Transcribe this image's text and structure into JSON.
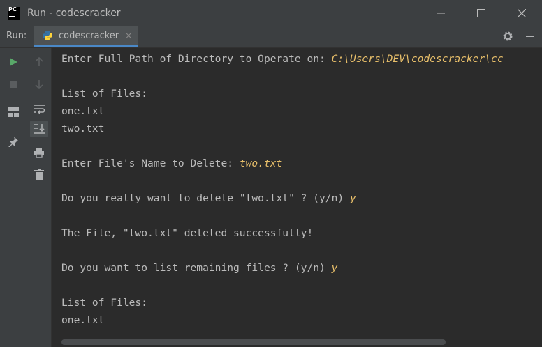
{
  "window": {
    "title": "Run - codescracker",
    "controls": [
      "minimize-icon",
      "maximize-icon",
      "close-icon"
    ]
  },
  "run_panel": {
    "label": "Run:",
    "tab": {
      "label": "codescracker",
      "icon": "python-icon",
      "close": "×"
    }
  },
  "left_toolbar": [
    "run-icon",
    "stop-icon",
    "layout-icon",
    "pin-icon"
  ],
  "second_toolbar": [
    "up-arrow-icon",
    "down-arrow-icon",
    "soft-wrap-icon",
    "scroll-to-end-icon",
    "print-icon",
    "trash-icon"
  ],
  "console": {
    "lines": [
      {
        "text": "Enter Full Path of Directory to Operate on: ",
        "input": "C:\\Users\\DEV\\codescracker\\cc"
      },
      {
        "text": "List of Files:",
        "input": ""
      },
      {
        "text": "one.txt",
        "input": ""
      },
      {
        "text": "two.txt",
        "input": ""
      },
      {
        "text": "Enter File's Name to Delete: ",
        "input": "two.txt"
      },
      {
        "text": "Do you really want to delete \"two.txt\" ? (y/n) ",
        "input": "y"
      },
      {
        "text": "The File, \"two.txt\" deleted successfully!",
        "input": ""
      },
      {
        "text": "Do you want to list remaining files ? (y/n) ",
        "input": "y"
      },
      {
        "text": "List of Files:",
        "input": ""
      },
      {
        "text": "one.txt",
        "input": ""
      }
    ]
  },
  "colors": {
    "background": "#2b2b2b",
    "chrome": "#3c3f41",
    "text": "#bbbbbb",
    "user_input": "#e8bf6a",
    "run_green": "#59a869"
  }
}
